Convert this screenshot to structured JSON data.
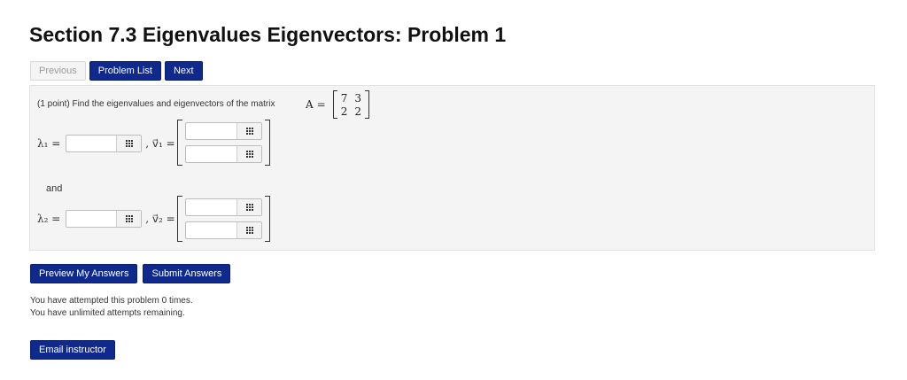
{
  "page": {
    "title": "Section 7.3 Eigenvalues Eigenvectors: Problem 1"
  },
  "nav": {
    "previous": "Previous",
    "problem_list": "Problem List",
    "next": "Next"
  },
  "problem": {
    "prompt": "(1 point) Find the eigenvalues and eigenvectors of the matrix",
    "matrix_label": "A",
    "equals": "=",
    "matrix": [
      [
        "7",
        "3"
      ],
      [
        "2",
        "2"
      ]
    ],
    "lambda1_label": "λ₁ =",
    "v1_label": ", v⃗₁ =",
    "and_text": "and",
    "lambda2_label": "λ₂ =",
    "v2_label": ", v⃗₂ =",
    "answers": {
      "lambda1": "",
      "v1_top": "",
      "v1_bottom": "",
      "lambda2": "",
      "v2_top": "",
      "v2_bottom": ""
    }
  },
  "actions": {
    "preview": "Preview My Answers",
    "submit": "Submit Answers"
  },
  "status": {
    "attempts": "You have attempted this problem 0 times.",
    "remaining": "You have unlimited attempts remaining."
  },
  "email": {
    "label": "Email instructor"
  },
  "colors": {
    "button_bg": "#0f2a8c",
    "panel_bg": "#f4f4f4"
  },
  "icons": {
    "answer_helper": "matrix-grid-icon"
  }
}
